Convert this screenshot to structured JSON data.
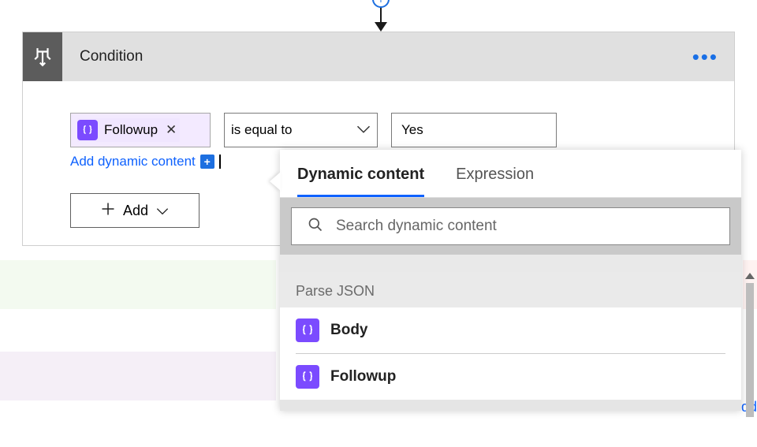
{
  "header": {
    "title": "Condition"
  },
  "condition": {
    "token_label": "Followup",
    "operator": "is equal to",
    "value": "Yes",
    "add_dynamic_link": "Add dynamic content",
    "add_button": "Add"
  },
  "flyout": {
    "tabs": {
      "dynamic": "Dynamic content",
      "expression": "Expression"
    },
    "search_placeholder": "Search dynamic content",
    "section": {
      "title": "Parse JSON",
      "items": [
        {
          "label": "Body"
        },
        {
          "label": "Followup"
        }
      ]
    }
  },
  "fragments": {
    "add_prefix": "dd"
  }
}
